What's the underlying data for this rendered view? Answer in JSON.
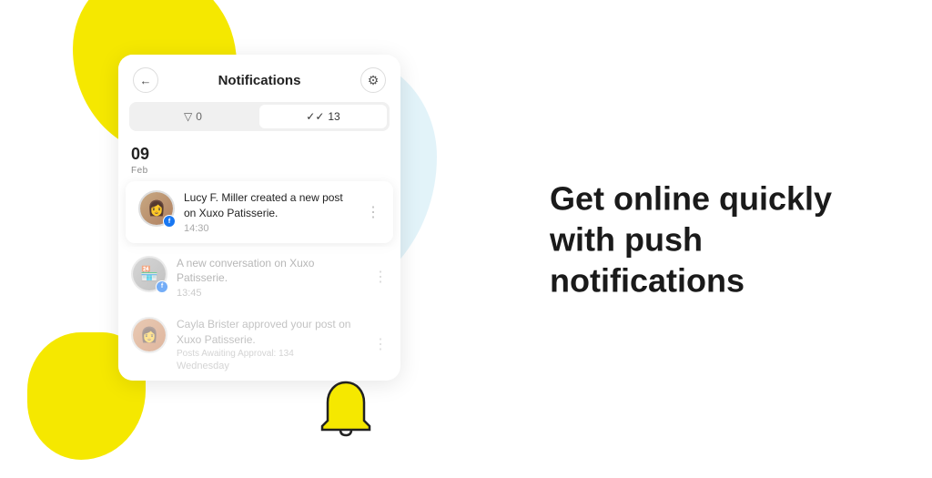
{
  "blobs": {
    "yellow_top": "blob-yellow-top",
    "blue": "blob-blue",
    "yellow_bottom": "blob-yellow-bottom"
  },
  "card": {
    "title": "Notifications",
    "back_label": "←",
    "gear_label": "⚙",
    "tabs": [
      {
        "icon": "▽",
        "count": "0",
        "active": false
      },
      {
        "icon": "✓✓",
        "count": "13",
        "active": true
      }
    ],
    "date_day": "09",
    "date_month": "Feb"
  },
  "notifications": [
    {
      "id": 1,
      "name": "Lucy F. Miller",
      "text": "Lucy F. Miller created a new post on Xuxo Patisserie.",
      "time": "14:30",
      "highlighted": true,
      "has_badge": true
    },
    {
      "id": 2,
      "name": "Xuxo Patisserie",
      "text": "A new conversation on Xuxo Patisserie.",
      "time": "13:45",
      "highlighted": false,
      "has_badge": true
    },
    {
      "id": 3,
      "name": "Cayla Brister",
      "text": "Cayla Brister approved your post on Xuxo Patisserie.",
      "sub": "Posts Awaiting Approval: 134",
      "time": "Wednesday",
      "highlighted": false,
      "has_badge": false
    }
  ],
  "hero": {
    "line1": "Get online quickly",
    "line2": "with push notifications"
  },
  "icons": {
    "back": "←",
    "gear": "⚙",
    "dots": "⋮",
    "facebook": "f",
    "bell": "bell"
  }
}
